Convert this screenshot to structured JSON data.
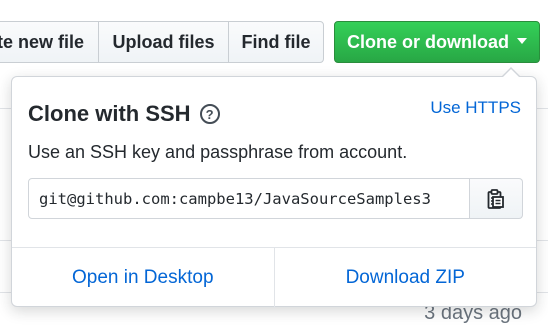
{
  "toolbar": {
    "create_label": "Create new file",
    "upload_label": "Upload files",
    "find_label": "Find file",
    "clone_label": "Clone or download"
  },
  "clone_menu": {
    "title": "Clone with SSH",
    "help_icon": "question-circle-icon",
    "switch_label": "Use HTTPS",
    "description": "Use an SSH key and passphrase from account.",
    "url_value": "git@github.com:campbe13/JavaSourceSamples3",
    "copy_icon": "clipboard-icon",
    "open_desktop_label": "Open in Desktop",
    "download_zip_label": "Download ZIP"
  },
  "background": {
    "last_updated": "3 days ago"
  },
  "colors": {
    "clone_button": "#28a745",
    "link": "#0366d6"
  }
}
